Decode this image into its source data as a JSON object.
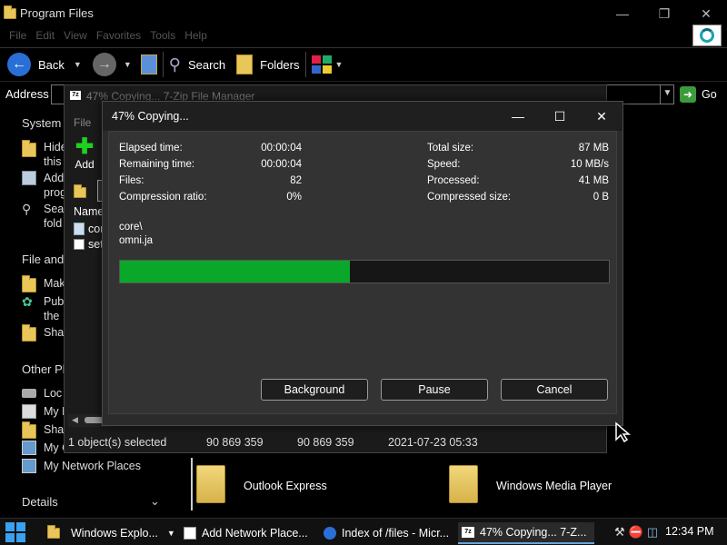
{
  "explorer": {
    "title": "Program Files",
    "menu": [
      "File",
      "Edit",
      "View",
      "Favorites",
      "Tools",
      "Help"
    ],
    "toolbar": {
      "back": "Back",
      "search": "Search",
      "folders": "Folders"
    },
    "address_label": "Address",
    "go_label": "Go",
    "taskpane": {
      "system_tasks": "System T",
      "system_items": [
        "Hide this",
        "Add progr",
        "Search fold"
      ],
      "file_tasks": "File and",
      "file_items": [
        "Mak",
        "Pub the",
        "Sha"
      ],
      "other_places": "Other Pl",
      "other_items": [
        "Loc",
        "My D",
        "Sha",
        "My C",
        "My Network Places"
      ],
      "details": "Details"
    },
    "folders": [
      "Outlook Express",
      "Windows Media Player"
    ]
  },
  "file_manager": {
    "title": "47% Copying... 7-Zip File Manager",
    "menu_file": "File",
    "add_label": "Add",
    "list_header": "Name",
    "list_items": [
      "cor",
      "set"
    ],
    "status": {
      "selected": "1 object(s) selected",
      "size": "90 869 359",
      "packed": "90 869 359",
      "date": "2021-07-23 05:33"
    }
  },
  "dialog": {
    "title": "47% Copying...",
    "stats_left": [
      {
        "label": "Elapsed time:",
        "value": "00:00:04"
      },
      {
        "label": "Remaining time:",
        "value": "00:00:04"
      },
      {
        "label": "Files:",
        "value": "82"
      },
      {
        "label": "Compression ratio:",
        "value": "0%"
      }
    ],
    "stats_right": [
      {
        "label": "Total size:",
        "value": "87 MB"
      },
      {
        "label": "Speed:",
        "value": "10 MB/s"
      },
      {
        "label": "Processed:",
        "value": "41 MB"
      },
      {
        "label": "Compressed size:",
        "value": "0 B"
      }
    ],
    "current_path": "core\\",
    "current_file": "omni.ja",
    "progress_percent": 47,
    "progress_color": "#0aa82a",
    "buttons": {
      "background": "Background",
      "pause": "Pause",
      "cancel": "Cancel"
    }
  },
  "taskbar": {
    "tasks": [
      "Windows Explo...",
      "Add Network Place...",
      "Index of /files - Micr...",
      "47% Copying... 7-Z..."
    ],
    "clock": "12:34 PM"
  }
}
